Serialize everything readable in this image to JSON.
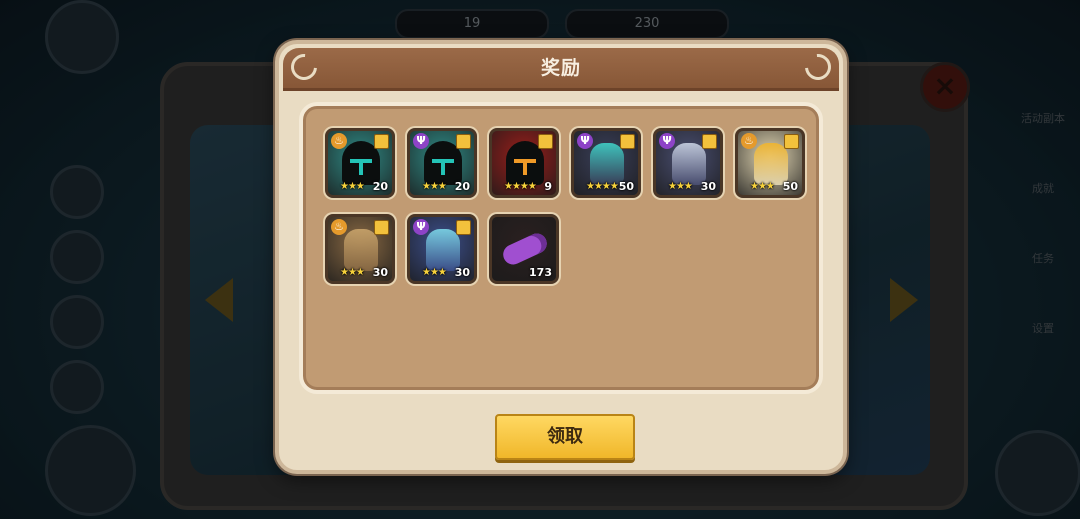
{
  "top_bar": {
    "resource_1": "19",
    "resource_2": "230"
  },
  "side_labels": [
    "活动副本",
    "成就",
    "任务",
    "设置"
  ],
  "dialog": {
    "title": "奖励",
    "claim_label": "领取"
  },
  "rewards": [
    {
      "name": "hooded-shadow-hero-teal",
      "faction_icon": "fire-badge-icon",
      "faction_color": "#e59a2c",
      "stars": "★★★",
      "count": "20",
      "portrait_bg": "#2f8b86",
      "accent": "#24c4b7"
    },
    {
      "name": "hooded-shadow-hero-teal-purple",
      "faction_icon": "trident-badge-icon",
      "faction_color": "#8d43c7",
      "stars": "★★★",
      "count": "20",
      "portrait_bg": "#2f8b86",
      "accent": "#24c4b7"
    },
    {
      "name": "hooded-shadow-hero-red",
      "faction_icon": "",
      "faction_color": "",
      "stars": "★★★★",
      "count": "9",
      "portrait_bg": "#9b1e1a",
      "accent": "#f09a27"
    },
    {
      "name": "dark-armored-knight",
      "faction_icon": "trident-badge-icon",
      "faction_color": "#8d43c7",
      "stars": "★★★★",
      "count": "50",
      "portrait_bg": "#3a3f5a",
      "accent": "#3fd1c7"
    },
    {
      "name": "silver-wolf-knight",
      "faction_icon": "trident-badge-icon",
      "faction_color": "#8d43c7",
      "stars": "★★★",
      "count": "30",
      "portrait_bg": "#4a4f72",
      "accent": "#c9d2e3"
    },
    {
      "name": "golden-paladin-helmet",
      "faction_icon": "fire-badge-icon",
      "faction_color": "#e59a2c",
      "stars": "★★★",
      "count": "50",
      "portrait_bg": "#e4d8b4",
      "accent": "#f0b42c"
    },
    {
      "name": "bronze-knight",
      "faction_icon": "fire-badge-icon",
      "faction_color": "#e59a2c",
      "stars": "★★★",
      "count": "30",
      "portrait_bg": "#8a6a44",
      "accent": "#c9a46b"
    },
    {
      "name": "blue-armored-knight",
      "faction_icon": "trident-badge-icon",
      "faction_color": "#8d43c7",
      "stars": "★★★",
      "count": "30",
      "portrait_bg": "#3c4f8c",
      "accent": "#7dd7e8"
    },
    {
      "name": "purple-log-material",
      "faction_icon": "",
      "faction_color": "",
      "stars": "",
      "count": "173",
      "portrait_bg": "#2a2020",
      "accent": "#a04fd0"
    }
  ]
}
